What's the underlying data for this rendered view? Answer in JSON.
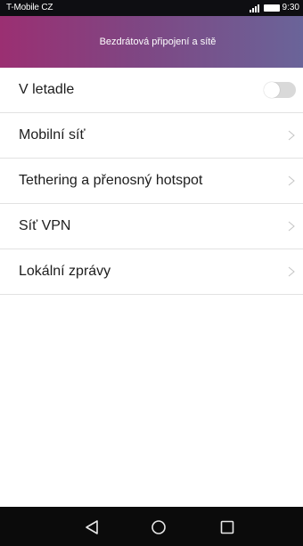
{
  "status_bar": {
    "carrier": "T-Mobile CZ",
    "time": "9:30",
    "icons": [
      "signal-icon",
      "battery-icon"
    ]
  },
  "header": {
    "title": "Bezdrátová připojení a sítě",
    "gradient_colors": [
      "#9b2f72",
      "#6a6499"
    ]
  },
  "settings": {
    "items": [
      {
        "label": "V letadle",
        "control": "toggle",
        "enabled": false
      },
      {
        "label": "Mobilní síť",
        "control": "chevron"
      },
      {
        "label": "Tethering a přenosný hotspot",
        "control": "chevron"
      },
      {
        "label": "Síť VPN",
        "control": "chevron"
      },
      {
        "label": "Lokální zprávy",
        "control": "chevron"
      }
    ]
  },
  "nav_bar": {
    "buttons": [
      "back-icon",
      "home-icon",
      "recent-apps-icon"
    ]
  }
}
